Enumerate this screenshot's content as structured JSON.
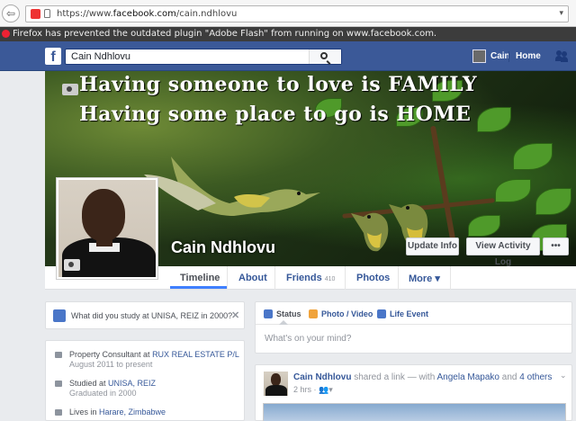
{
  "browser": {
    "url_prefix": "https://www.",
    "url_host": "facebook.com",
    "url_path": "/cain.ndhlovu",
    "back_glyph": "⇦",
    "dropdown_glyph": "▾",
    "notice": "Firefox has prevented the outdated plugin \"Adobe Flash\" from running on www.facebook.com."
  },
  "fbbar": {
    "logo": "f",
    "search_value": "Cain Ndhlovu",
    "user_name": "Cain",
    "home_label": "Home"
  },
  "cover": {
    "line1": "Having someone to love is FAMILY",
    "line2": "Having some place to go is HOME",
    "profile_name": "Cain Ndhlovu",
    "update_info": "Update Info",
    "view_activity": "View Activity Log",
    "more": "•••"
  },
  "tabs": {
    "timeline": "Timeline",
    "about": "About",
    "friends": "Friends",
    "friends_count": "410",
    "photos": "Photos",
    "more": "More ▾"
  },
  "prompt": {
    "text": "What did you study at UNISA, REIZ in 2000?",
    "close": "✕"
  },
  "about": {
    "work_prefix": "Property Consultant at ",
    "work_link": "RUX REAL ESTATE P/L",
    "work_sub": "August 2011 to present",
    "study_prefix": "Studied at ",
    "study_link": "UNISA, REIZ",
    "study_sub": "Graduated in 2000",
    "lives_prefix": "Lives in ",
    "lives_link": "Harare, Zimbabwe"
  },
  "composer": {
    "status": "Status",
    "photo_video": "Photo / Video",
    "life_event": "Life Event",
    "placeholder": "What's on your mind?"
  },
  "post": {
    "author": "Cain Ndhlovu",
    "action": " shared a link — with ",
    "tagged": "Angela Mapako",
    "and_others_prefix": " and ",
    "others": "4 others",
    "time": "2 hrs · ",
    "audience_glyph": "👥▾",
    "chevron": "⌄"
  },
  "colors": {
    "fb_blue": "#3b5998",
    "link_blue": "#365899",
    "tab_underline": "#4080ff"
  }
}
